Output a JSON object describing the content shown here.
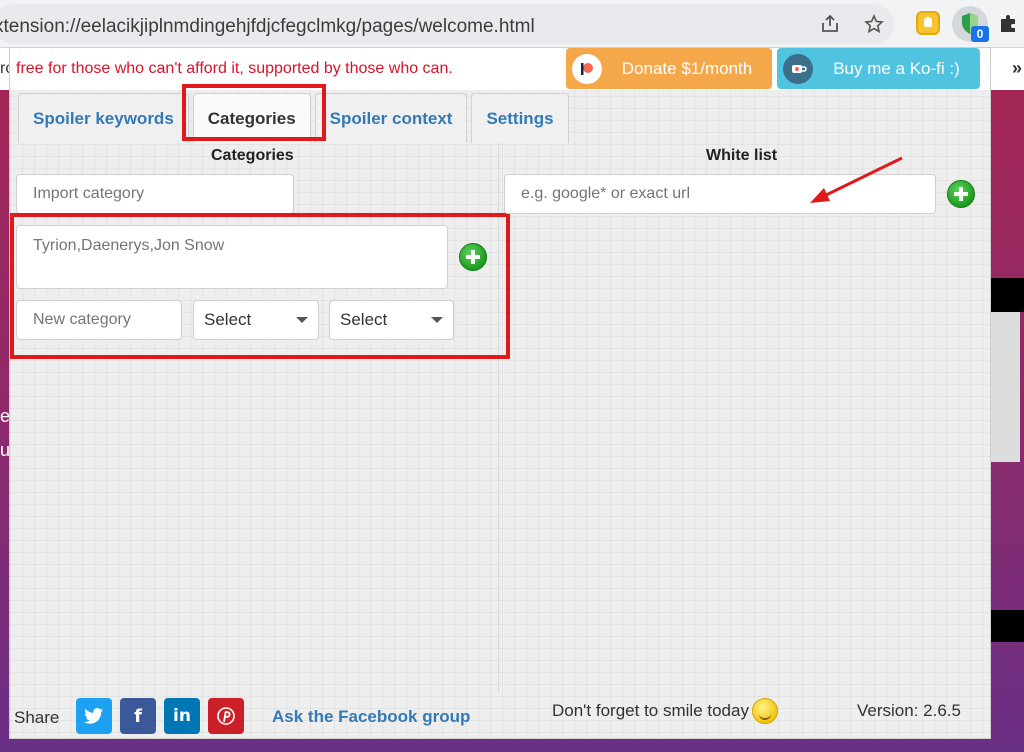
{
  "browser": {
    "url": "xtension://eelacikjiplnmdingehjfdjcfegclmkg/pages/welcome.html",
    "extension_badge_count": "0",
    "overflow_glyph": "»",
    "left_edge_char": "rc"
  },
  "header": {
    "tagline": "free for those who can't afford it, supported by those who can.",
    "donate_label": "Donate $1/month",
    "kofi_label": "Buy me a Ko-fi :)"
  },
  "tabs": [
    {
      "label": "Spoiler keywords"
    },
    {
      "label": "Categories"
    },
    {
      "label": "Spoiler context"
    },
    {
      "label": "Settings"
    }
  ],
  "categories": {
    "title": "Categories",
    "import_placeholder": "Import category",
    "keywords_placeholder": "Tyrion,Daenerys,Jon Snow",
    "new_category_placeholder": "New category",
    "select_1": "Select",
    "select_2": "Select"
  },
  "whitelist": {
    "title": "White list",
    "url_placeholder": "e.g. google* or exact url"
  },
  "footer": {
    "share_label": "Share",
    "facebook_group_link": "Ask the Facebook group",
    "smile_text": "Don't forget to smile today",
    "version_text": "Version: 2.6.5"
  },
  "colors": {
    "accent_link": "#337ab7",
    "highlight_red": "#e01a1a",
    "donate_orange": "#f4a84a",
    "kofi_blue": "#4fc3e0",
    "twitter": "#1da1f2",
    "facebook": "#3b5998",
    "linkedin": "#0077b5",
    "pinterest": "#cb2027"
  },
  "icons": {
    "share": "share-icon",
    "star": "star-icon",
    "puzzle": "puzzle-icon",
    "add": "plus-circle-icon"
  }
}
